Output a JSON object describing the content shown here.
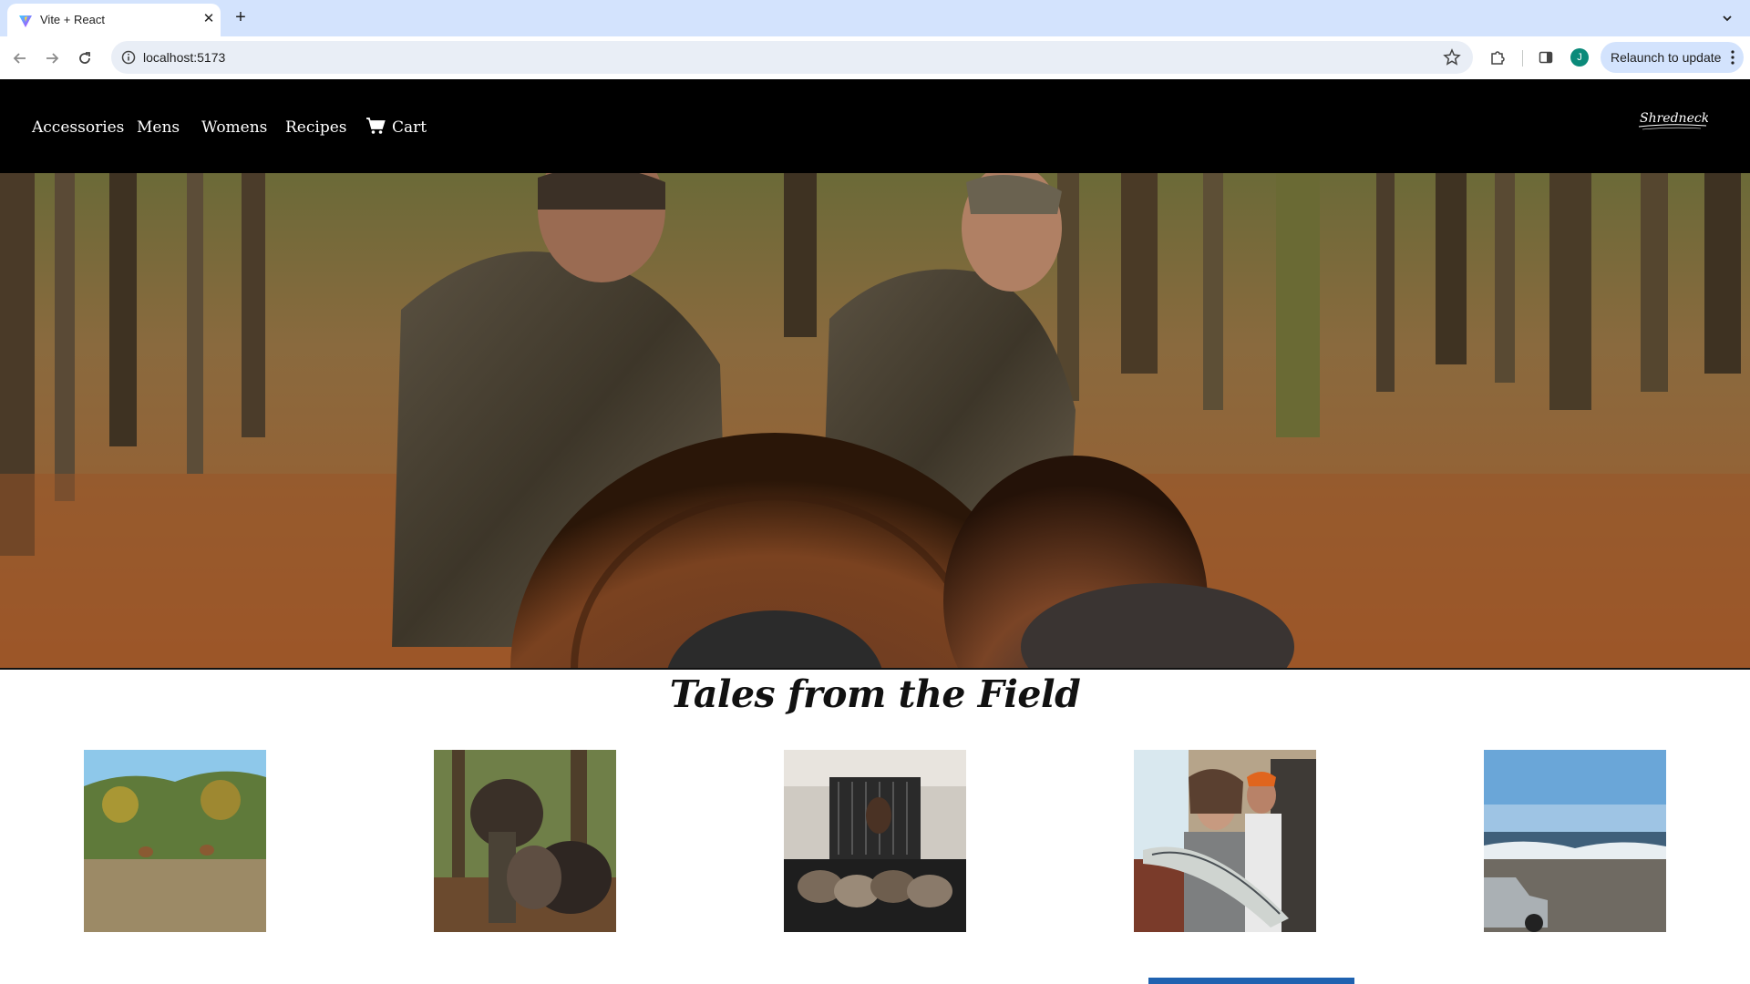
{
  "browser": {
    "tab_title": "Vite + React",
    "url": "localhost:5173",
    "avatar_initial": "J",
    "relaunch_label": "Relaunch to update"
  },
  "site": {
    "nav": {
      "accessories": "Accessories",
      "mens": "Mens",
      "womens": "Womens",
      "recipes": "Recipes",
      "cart": "Cart"
    },
    "brand_logo": "Shredneckz",
    "section_title": "Tales from the Field",
    "thumbnails": [
      {
        "subject": "deer in dune grass"
      },
      {
        "subject": "hunter carrying turkeys"
      },
      {
        "subject": "dog on truck with ducks"
      },
      {
        "subject": "woman holding striped bass"
      },
      {
        "subject": "beach with truck"
      }
    ]
  },
  "colors": {
    "tabstrip": "#d3e3fd",
    "header": "#000000",
    "accent_bar": "#1f62b0"
  }
}
